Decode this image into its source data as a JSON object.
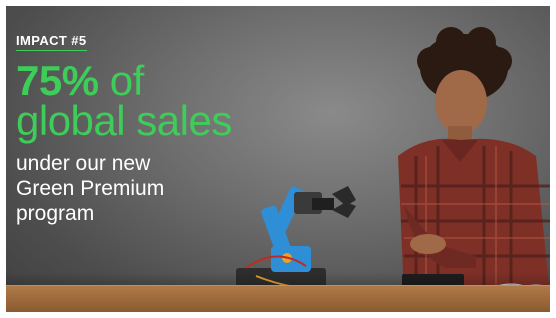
{
  "slide": {
    "kicker": "IMPACT #5",
    "headline_number": "75%",
    "headline_line1_rest": " of",
    "headline_line2": "global sales",
    "subtext": "under our new\nGreen Premium\nprogram"
  },
  "colors": {
    "accent_green": "#3dcd58",
    "text_white": "#ffffff",
    "background_gray": "#6f6f6f",
    "bench_wood": "#9c6a3c",
    "robot_blue": "#2e8fd6",
    "shirt_plaid_red": "#8c3a2e"
  },
  "photo": {
    "subject": "child assembling a blue robotic arm at a wooden workbench",
    "icon": "photo-icon"
  }
}
